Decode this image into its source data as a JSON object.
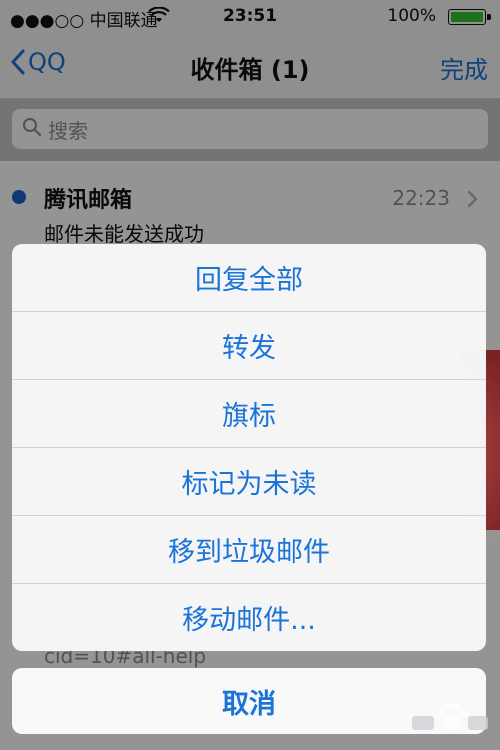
{
  "status_bar": {
    "carrier": "●●●○○ 中国联通",
    "time": "23:51",
    "battery_percent": "100%",
    "battery_level": 1.0
  },
  "nav_bar": {
    "back_label": "QQ",
    "title": "收件箱 (1)",
    "done_label": "完成"
  },
  "search": {
    "placeholder": "搜索"
  },
  "mail_list": {
    "items": [
      {
        "sender": "腾讯邮箱",
        "time": "22:23",
        "subject": "邮件未能发送成功",
        "unread": true
      }
    ],
    "peek_text": "cid=10#all-help"
  },
  "action_sheet": {
    "items": [
      {
        "label": "回复全部"
      },
      {
        "label": "转发"
      },
      {
        "label": "旗标"
      },
      {
        "label": "标记为未读"
      },
      {
        "label": "移到垃圾邮件"
      },
      {
        "label": "移动邮件..."
      }
    ],
    "cancel_label": "取消"
  },
  "colors": {
    "accent": "#1a73d8",
    "unread_dot": "#1a62c9",
    "battery": "#35c233"
  }
}
